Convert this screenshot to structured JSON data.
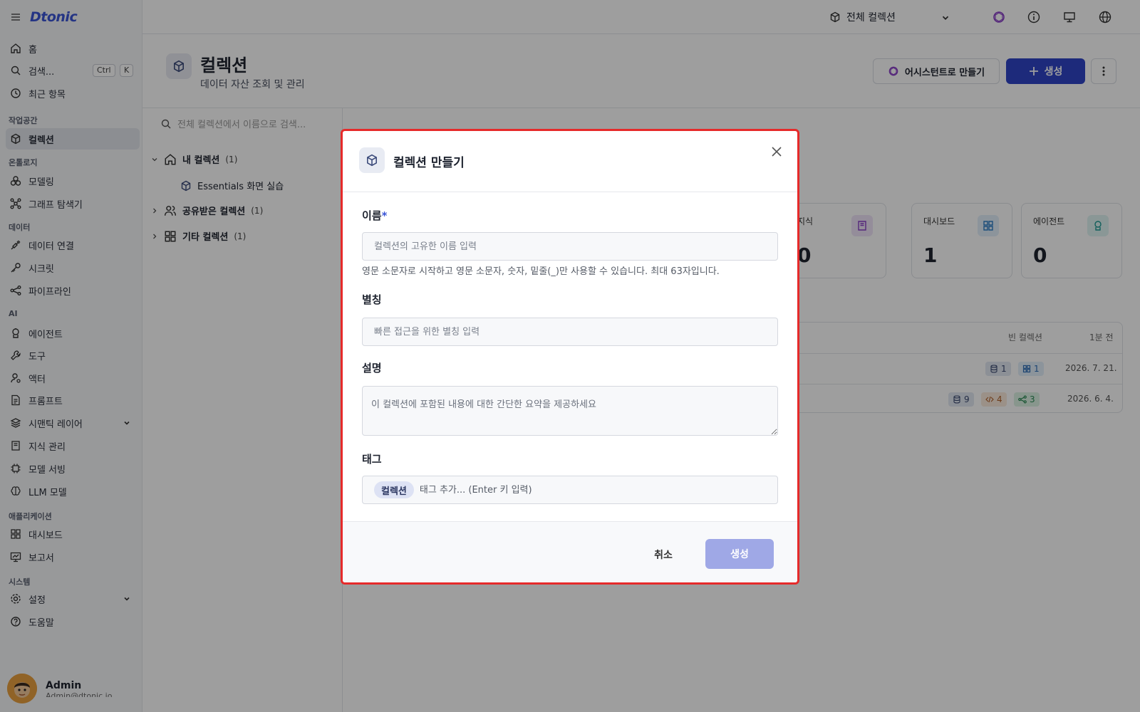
{
  "app": {
    "logo": "Dtonic"
  },
  "sidebar": {
    "home": "홈",
    "search": "검색...",
    "search_kbd": [
      "Ctrl",
      "K"
    ],
    "recent": "최근 항목",
    "sections": {
      "workspace": "작업공간",
      "ontology": "온톨로지",
      "data": "데이터",
      "ai": "AI",
      "apps": "애플리케이션",
      "system": "시스템"
    },
    "items": {
      "collection": "컬렉션",
      "modeling": "모델링",
      "graph": "그래프 탐색기",
      "data_conn": "데이터 연결",
      "secret": "시크릿",
      "pipeline": "파이프라인",
      "agent": "에이전트",
      "tool": "도구",
      "actor": "액터",
      "prompt": "프롬프트",
      "semantic": "시맨틱 레이어",
      "knowledge": "지식 관리",
      "serving": "모델 서빙",
      "llm": "LLM 모델",
      "dashboard": "대시보드",
      "report": "보고서",
      "settings": "설정",
      "help": "도움말"
    },
    "profile": {
      "name": "Admin",
      "email": "Admin@dtonic.io"
    }
  },
  "topbar": {
    "selector": "전체 컬렉션"
  },
  "page": {
    "title": "컬렉션",
    "subtitle": "데이터 자산 조회 및 관리",
    "assist_button": "어시스턴트로 만들기",
    "create_button": "생성"
  },
  "tree": {
    "search_placeholder": "전체 컬렉션에서 이름으로 검색...",
    "my": {
      "label": "내 컬렉션",
      "count": "(1)"
    },
    "my_child": "Essentials 화면 실습",
    "shared": {
      "label": "공유받은 컬렉션",
      "count": "(1)"
    },
    "other": {
      "label": "기타 컬렉션",
      "count": "(1)"
    }
  },
  "stats": [
    {
      "label": "지식",
      "value": "0"
    },
    {
      "label": "대시보드",
      "value": "1"
    },
    {
      "label": "에이전트",
      "value": "0"
    }
  ],
  "list": {
    "head_type": "빈 컬렉션",
    "head_time": "1분 전",
    "rows": [
      {
        "chips": [
          "1",
          "1"
        ],
        "date": "2026. 7. 21."
      },
      {
        "chips": [
          "9",
          "4",
          "3"
        ],
        "date": "2026. 6. 4."
      }
    ]
  },
  "modal": {
    "title": "컬렉션 만들기",
    "name_label": "이름",
    "name_required": "*",
    "name_placeholder": "컬렉션의 고유한 이름 입력",
    "name_help": "영문 소문자로 시작하고 영문 소문자, 숫자, 밑줄(_)만 사용할 수 있습니다. 최대 63자입니다.",
    "alias_label": "별칭",
    "alias_placeholder": "빠른 접근을 위한 별칭 입력",
    "desc_label": "설명",
    "desc_placeholder": "이 컬렉션에 포함된 내용에 대한 간단한 요약을 제공하세요",
    "tag_label": "태그",
    "tag_chip": "컬렉션",
    "tag_placeholder": "태그 추가... (Enter 키 입력)",
    "cancel": "취소",
    "submit": "생성"
  },
  "colors": {
    "accent": "#2f45c7",
    "submit_disabled": "#9fa8e6",
    "highlight": "#e62a2a"
  }
}
